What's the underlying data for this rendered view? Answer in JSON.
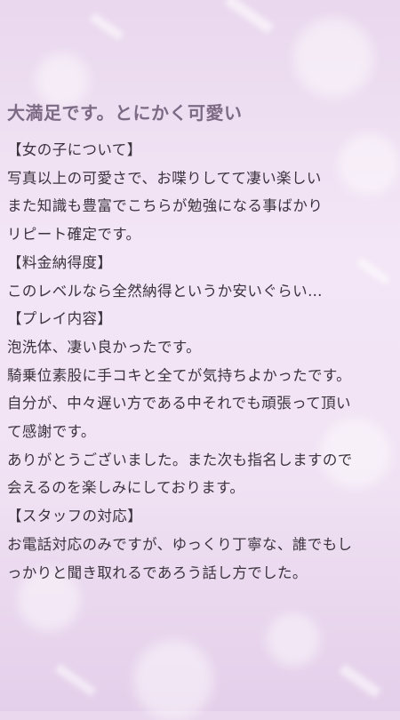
{
  "review": {
    "title": "大満足です。とにかく可愛い",
    "lines": [
      "【女の子について】",
      "写真以上の可愛さで、お喋りしてて凄い楽しい",
      "また知識も豊富でこちらが勉強になる事ばかり",
      "リピート確定です。",
      "【料金納得度】",
      "このレベルなら全然納得というか安いぐらい…",
      "【プレイ内容】",
      "泡洗体、凄い良かったです。",
      "騎乗位素股に手コキと全てが気持ちよかったです。",
      "自分が、中々遅い方である中それでも頑張って頂い",
      "て感謝です。",
      "ありがとうございました。また次も指名しますので",
      "会えるのを楽しみにしております。",
      "【スタッフの対応】",
      "お電話対応のみですが、ゆっくり丁寧な、誰でもし",
      "っかりと聞き取れるであろう話し方でした。"
    ]
  }
}
